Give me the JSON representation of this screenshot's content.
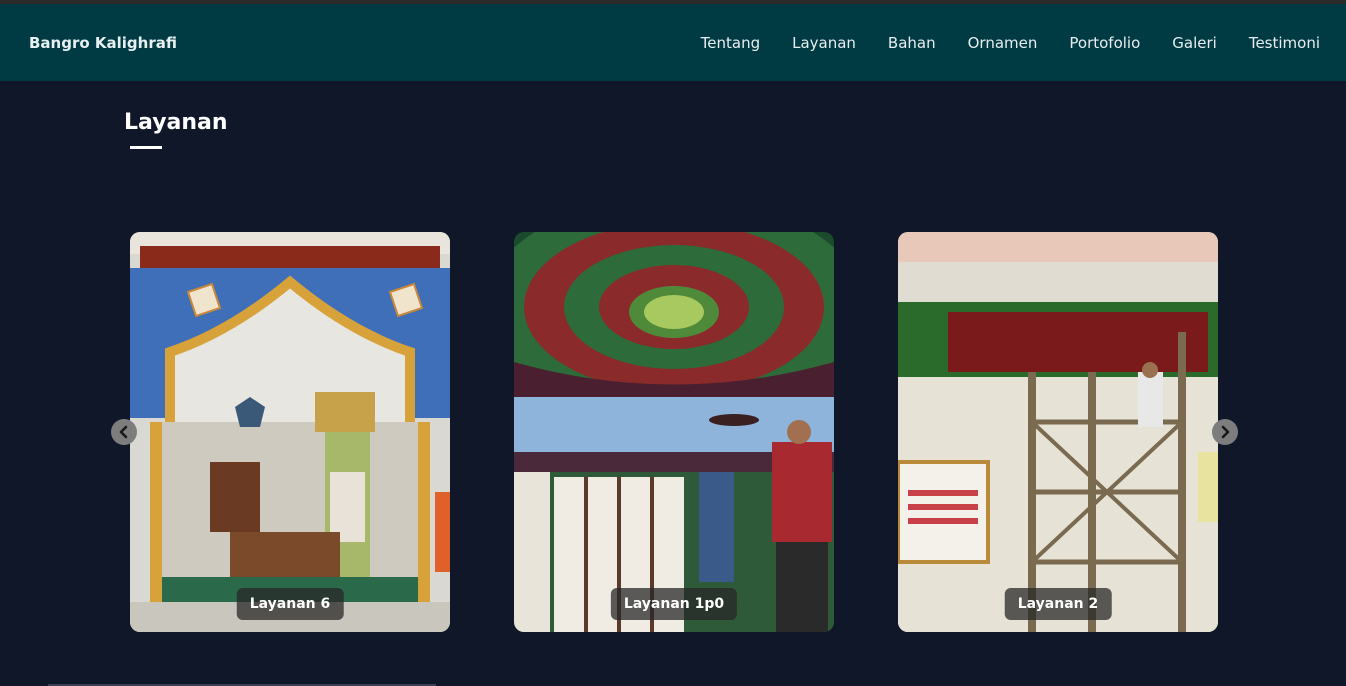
{
  "header": {
    "brand": "Bangro Kalighrafi",
    "nav": [
      "Tentang",
      "Layanan",
      "Bahan",
      "Ornamen",
      "Portofolio",
      "Galeri",
      "Testimoni"
    ]
  },
  "section": {
    "title": "Layanan"
  },
  "carousel": {
    "cards": [
      {
        "label": "Layanan 6"
      },
      {
        "label": "Layanan 1p0"
      },
      {
        "label": "Layanan 2"
      }
    ],
    "prev_icon": "chevron-left-icon",
    "next_icon": "chevron-right-icon"
  },
  "colors": {
    "navbar": "#003a42",
    "background": "#0f1729",
    "text": "#ffffff"
  }
}
